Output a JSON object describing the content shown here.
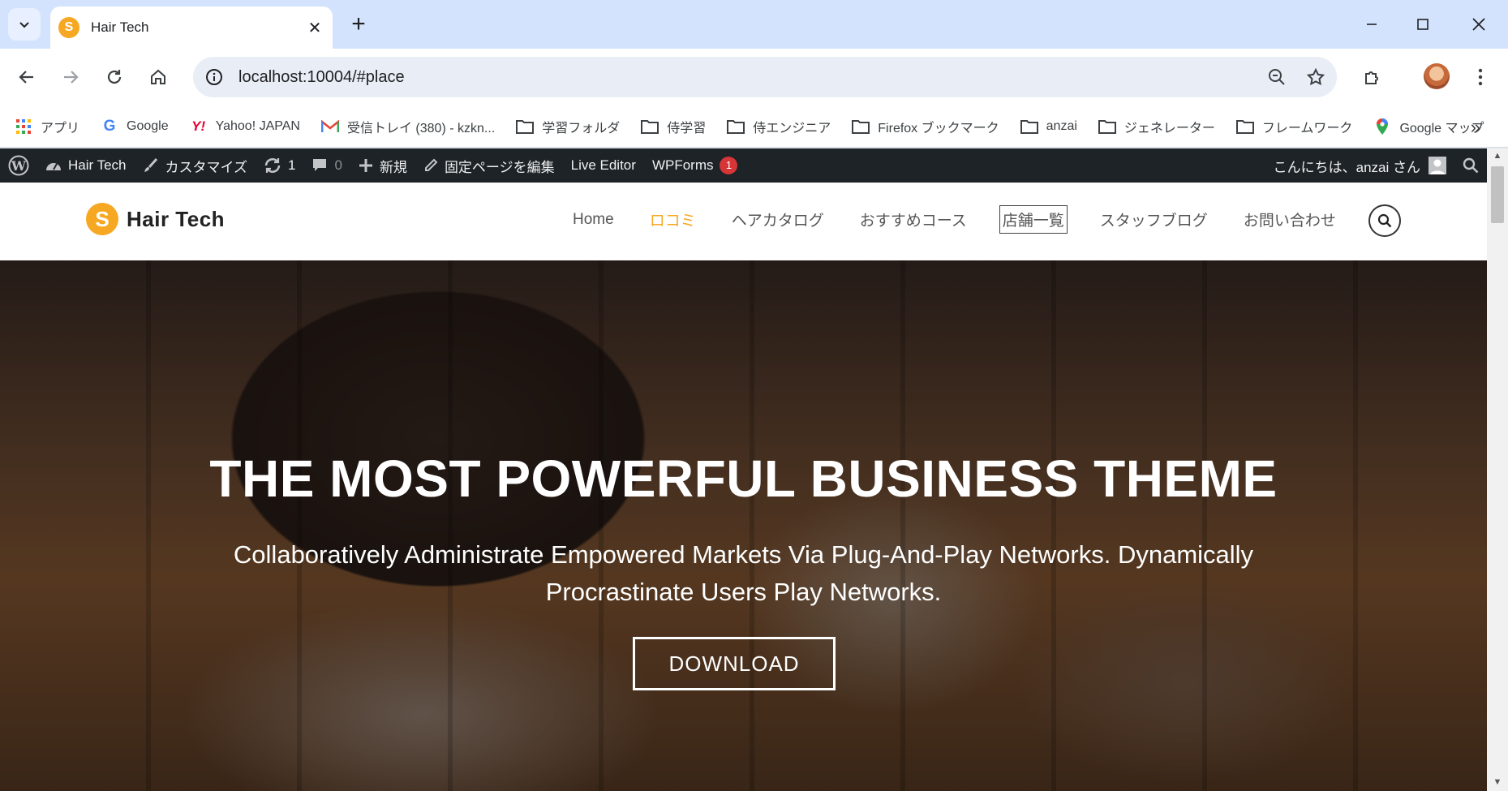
{
  "browser": {
    "tab_title": "Hair Tech",
    "url": "localhost:10004/#place",
    "new_tab_symbol": "+",
    "close_symbol": "✕"
  },
  "bookmarks": [
    {
      "label": "アプリ",
      "icon": "apps-grid-icon"
    },
    {
      "label": "Google",
      "icon": "google-icon"
    },
    {
      "label": "Yahoo! JAPAN",
      "icon": "yahoo-icon"
    },
    {
      "label": "受信トレイ (380) - kzkn...",
      "icon": "gmail-icon"
    },
    {
      "label": "学習フォルダ",
      "icon": "folder-icon"
    },
    {
      "label": "侍学習",
      "icon": "folder-icon"
    },
    {
      "label": "侍エンジニア",
      "icon": "folder-icon"
    },
    {
      "label": "Firefox ブックマーク",
      "icon": "folder-icon"
    },
    {
      "label": "anzai",
      "icon": "folder-icon"
    },
    {
      "label": "ジェネレーター",
      "icon": "folder-icon"
    },
    {
      "label": "フレームワーク",
      "icon": "folder-icon"
    },
    {
      "label": "Google マップ",
      "icon": "maps-pin-icon"
    }
  ],
  "bookmarks_more": "»",
  "wp_admin_bar": {
    "site_name": "Hair Tech",
    "customize": "カスタマイズ",
    "updates_count": "1",
    "comments_count": "0",
    "new": "新規",
    "edit_page": "固定ページを編集",
    "live_editor": "Live Editor",
    "wpforms": "WPForms",
    "wpforms_badge": "1",
    "greeting": "こんにちは、anzai さん"
  },
  "site": {
    "logo_text": "Hair Tech",
    "logo_letter": "S",
    "menu": [
      {
        "label": "Home",
        "state": "normal"
      },
      {
        "label": "ロコミ",
        "state": "active"
      },
      {
        "label": "ヘアカタログ",
        "state": "normal"
      },
      {
        "label": "おすすめコース",
        "state": "normal"
      },
      {
        "label": "店舗一覧",
        "state": "focused"
      },
      {
        "label": "スタッフブログ",
        "state": "normal"
      },
      {
        "label": "お問い合わせ",
        "state": "normal"
      }
    ],
    "accent_color": "#f7a823"
  },
  "hero": {
    "title": "THE MOST POWERFUL BUSINESS THEME",
    "subtitle_line1": "Collaboratively Administrate Empowered Markets Via Plug-And-Play Networks. Dynamically",
    "subtitle_line2": "Procrastinate Users Play Networks.",
    "button_label": "DOWNLOAD"
  }
}
